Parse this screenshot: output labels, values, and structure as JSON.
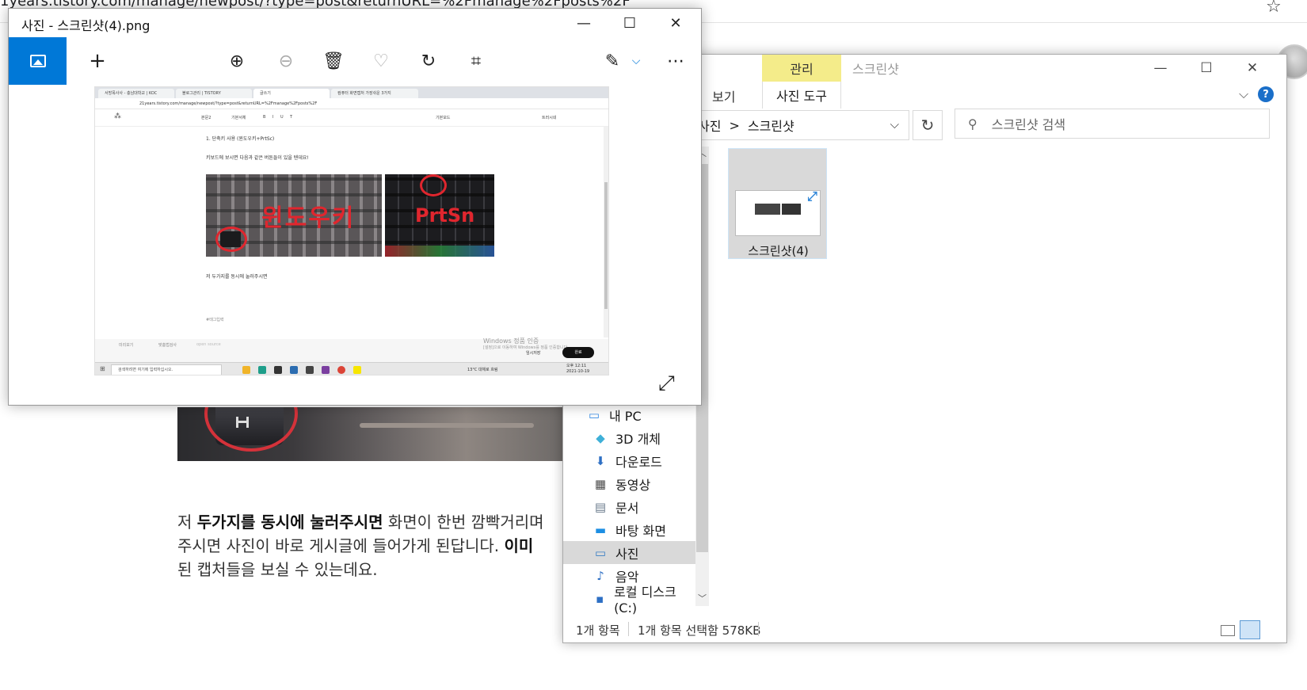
{
  "browser": {
    "url": "1years.tistory.com/manage/newpost/?type=post&returnURL=%2Fmanage%2Fposts%2F",
    "paragraph": {
      "part1": "저 ",
      "bold1": "두가지를 동시에 눌러주시면",
      "part2": " 화면이 한번 깜빡거리며",
      "line2a": "주시면 사진이 바로 게시글에 들어가게 된답니다. ",
      "bold2": "이미",
      "line3": "된 캡처들을 보실 수 있는데요."
    }
  },
  "explorer": {
    "manage_tab": "관리",
    "title": "스크린샷",
    "ribbon": {
      "view_tab": "보기",
      "tools_tab": "사진 도구"
    },
    "address": {
      "segment1": "사진",
      "separator": ">",
      "segment2": "스크린샷"
    },
    "search_placeholder": "스크린샷 검색",
    "nav": [
      {
        "label": "내 PC",
        "icon": "pc-icon"
      },
      {
        "label": "3D 개체",
        "icon": "cube-icon"
      },
      {
        "label": "다운로드",
        "icon": "download-icon"
      },
      {
        "label": "동영상",
        "icon": "film-icon"
      },
      {
        "label": "문서",
        "icon": "document-icon"
      },
      {
        "label": "바탕 화면",
        "icon": "desktop-icon"
      },
      {
        "label": "사진",
        "icon": "pictures-icon",
        "selected": true
      },
      {
        "label": "음악",
        "icon": "music-icon"
      },
      {
        "label": "로컬 디스크 (C:)",
        "icon": "disk-icon"
      }
    ],
    "file": {
      "name": "스크린샷(4)"
    },
    "status": {
      "count": "1개 항목",
      "selection": "1개 항목 선택함 578KB"
    },
    "colors": {
      "manage_tab": "#f4ec8a",
      "selection": "#d9d9d9",
      "accent": "#0078d7"
    }
  },
  "photos": {
    "title": "사진 - 스크린샷(4).png",
    "screenshot": {
      "tabs": [
        "서방목사사 - 충남대학교 | KOC",
        "블로그관리 | TISTORY",
        "글쓰기",
        "컴퓨터 화면캡처 가장쉬운 3가지"
      ],
      "url": "21years.tistory.com/manage/newpost/?type=post&returnURL=%2Fmanage%2Fposts%2F",
      "editor_menu": [
        "본문2",
        "기본서체",
        "B",
        "I",
        "U",
        "T",
        "기본모드",
        "트러시네"
      ],
      "line1": "1. 단축키 사용 (윈도우키+PrtSc)",
      "line2": "키보드에 보시면 다음과 같은 버튼들이 있을 텐데요!",
      "annotation1": "윈도우키",
      "annotation2": "PrtSn",
      "line3": "저 두가지를 동시에 눌러주시면",
      "tag_hint": "#태그입력",
      "footer_left": "미리보기",
      "footer_mid": "맞춤법검사",
      "footer_right": "open source",
      "watermark1": "Windows 정품 인증",
      "watermark2": "[설정]으로 이동하여 Windows를 정품 인증합니다.",
      "save_label": "임시저장",
      "done_label": "완료",
      "taskbar_search": "검색하려면 여기에 입력하십시오.",
      "weather": "13°C 대체로 흐림",
      "clock_time": "오후 12:11",
      "clock_date": "2021-10-19"
    }
  }
}
